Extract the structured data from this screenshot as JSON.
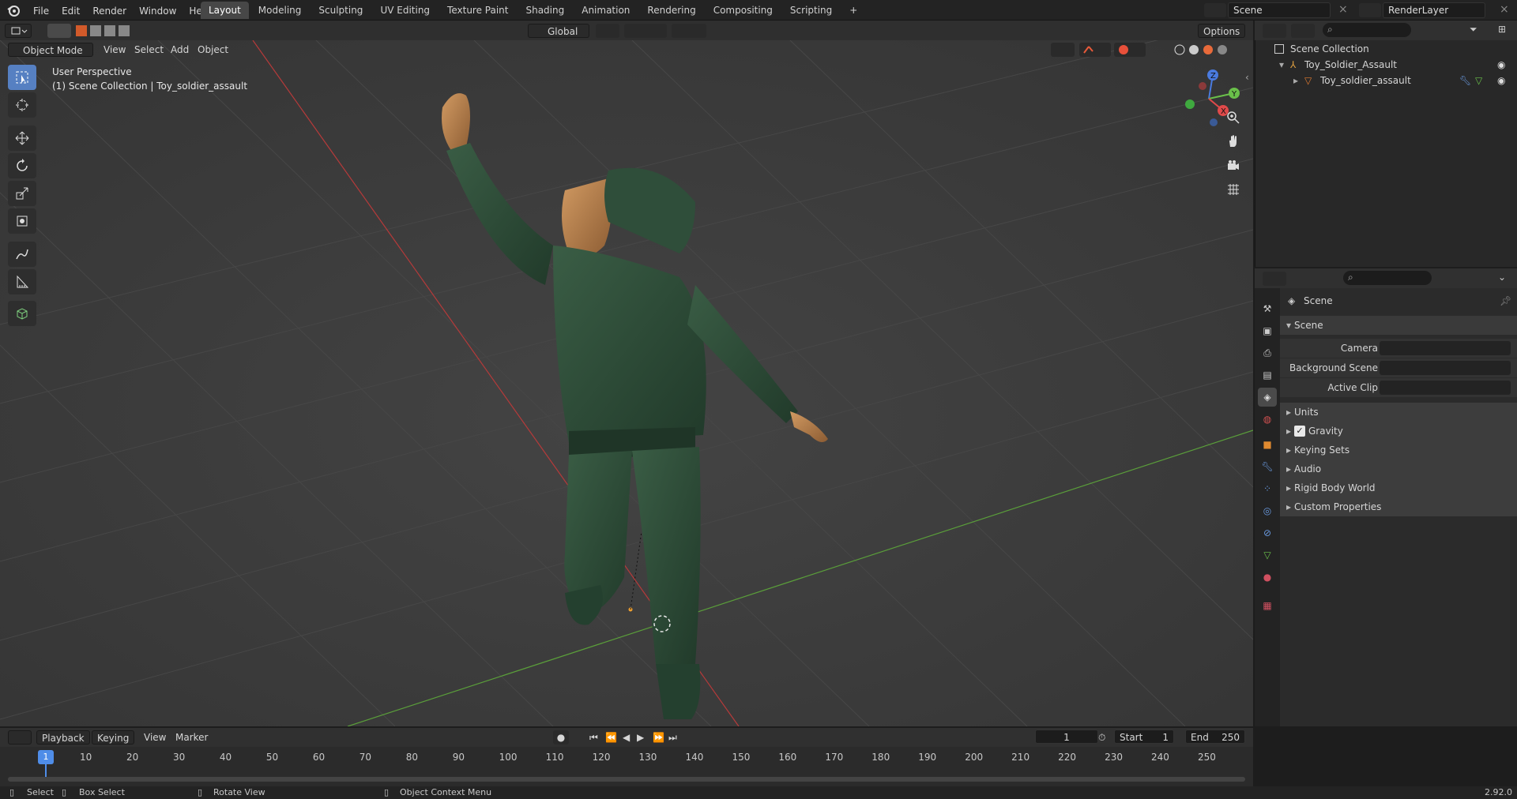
{
  "topbar": {
    "menu": [
      "File",
      "Edit",
      "Render",
      "Window",
      "Help"
    ],
    "workspaces": [
      "Layout",
      "Modeling",
      "Sculpting",
      "UV Editing",
      "Texture Paint",
      "Shading",
      "Animation",
      "Rendering",
      "Compositing",
      "Scripting"
    ],
    "active_workspace": "Layout",
    "add_tab": "+",
    "scene_name": "Scene",
    "render_layer": "RenderLayer"
  },
  "viewport_header": {
    "mode": "Object Mode",
    "menus": [
      "View",
      "Select",
      "Add",
      "Object"
    ],
    "transform_orientation": "Global",
    "options_label": "Options"
  },
  "viewport": {
    "perspective_label": "User Perspective",
    "context_label": "(1) Scene Collection | Toy_soldier_assault",
    "gizmo_axes": [
      "Z",
      "Y",
      "X"
    ],
    "grid_color": "#474747",
    "x_axis_color": "#b63a3a",
    "y_axis_color": "#5a9e3a",
    "model_color": "#2f4e3a"
  },
  "outliner": {
    "root": "Scene Collection",
    "collection": "Toy_Soldier_Assault",
    "object": "Toy_soldier_assault"
  },
  "properties": {
    "context_title": "Scene",
    "section_title": "Scene",
    "fields": {
      "camera_label": "Camera",
      "background_label": "Background Scene",
      "active_clip_label": "Active Clip"
    },
    "panels": [
      "Units",
      "Gravity",
      "Keying Sets",
      "Audio",
      "Rigid Body World",
      "Custom Properties"
    ],
    "gravity_checked": true
  },
  "timeline": {
    "menus": [
      "Playback",
      "Keying",
      "View",
      "Marker"
    ],
    "current_frame": "1",
    "start_label": "Start",
    "start_value": "1",
    "end_label": "End",
    "end_value": "250",
    "ticks": [
      "1",
      "10",
      "20",
      "30",
      "40",
      "50",
      "60",
      "70",
      "80",
      "90",
      "100",
      "110",
      "120",
      "130",
      "140",
      "150",
      "160",
      "170",
      "180",
      "190",
      "200",
      "210",
      "220",
      "230",
      "240",
      "250"
    ]
  },
  "statusbar": {
    "select": "Select",
    "box_select": "Box Select",
    "rotate_view": "Rotate View",
    "context_menu": "Object Context Menu",
    "version": "2.92.0"
  }
}
